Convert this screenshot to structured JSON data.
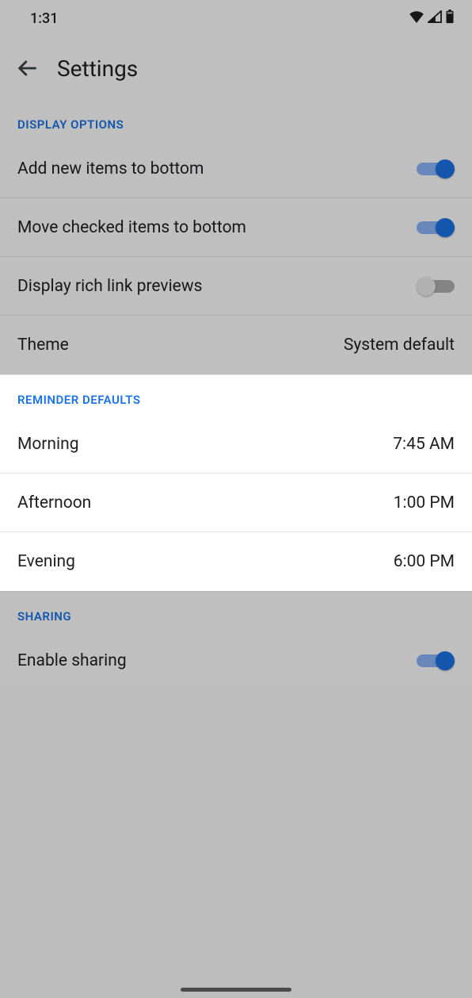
{
  "status": {
    "time": "1:31"
  },
  "header": {
    "title": "Settings"
  },
  "sections": {
    "display": {
      "header": "DISPLAY OPTIONS",
      "add_bottom": {
        "label": "Add new items to bottom",
        "on": true
      },
      "move_checked": {
        "label": "Move checked items to bottom",
        "on": true
      },
      "rich_link": {
        "label": "Display rich link previews",
        "on": false
      },
      "theme": {
        "label": "Theme",
        "value": "System default"
      }
    },
    "reminder": {
      "header": "REMINDER DEFAULTS",
      "morning": {
        "label": "Morning",
        "value": "7:45 AM"
      },
      "afternoon": {
        "label": "Afternoon",
        "value": "1:00 PM"
      },
      "evening": {
        "label": "Evening",
        "value": "6:00 PM"
      }
    },
    "sharing": {
      "header": "SHARING",
      "enable": {
        "label": "Enable sharing",
        "on": true
      }
    }
  }
}
